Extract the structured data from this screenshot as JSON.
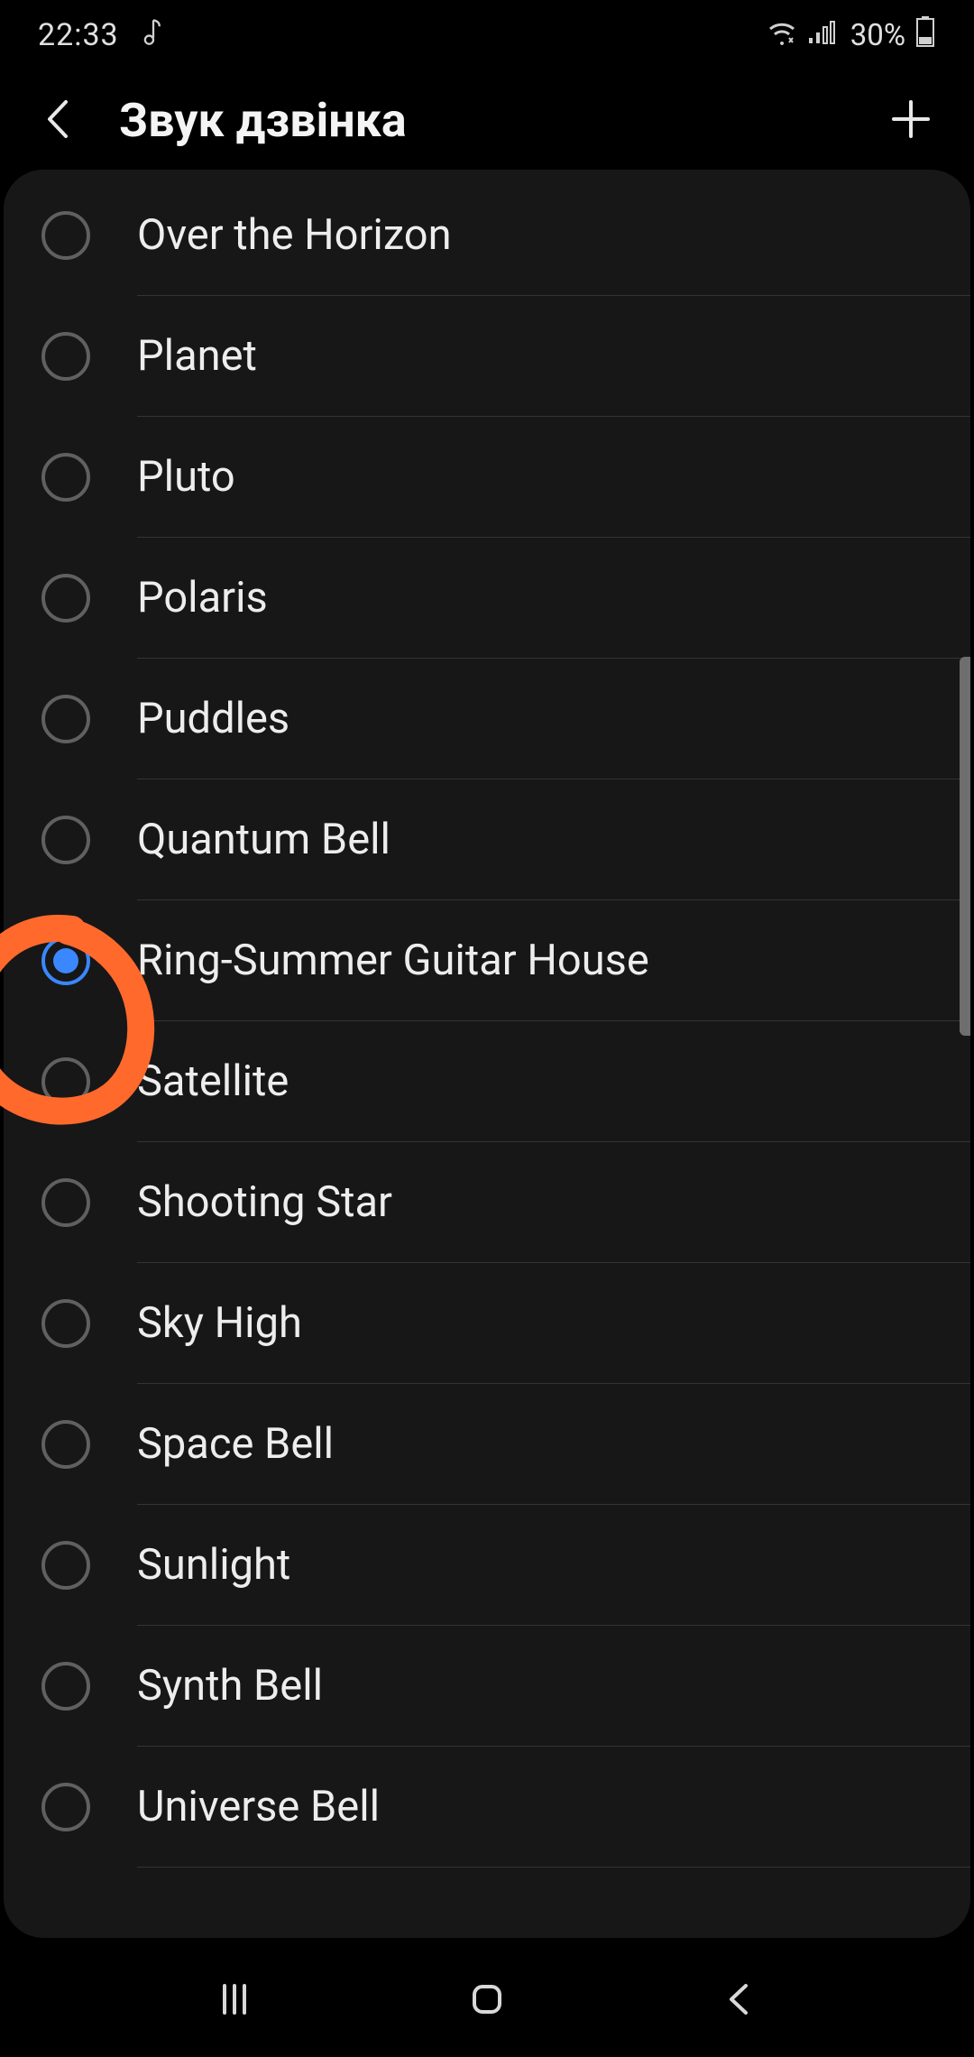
{
  "status_bar": {
    "time": "22:33",
    "music_icon": "music-note-icon",
    "wifi_icon": "wifi-icon",
    "signal_icon": "cell-signal-icon",
    "battery_percent": "30%",
    "battery_icon": "battery-icon"
  },
  "header": {
    "back_icon": "chevron-left-icon",
    "title": "Звук дзвінка",
    "add_icon": "plus-icon"
  },
  "ringtones": [
    {
      "label": "Over the Horizon",
      "selected": false
    },
    {
      "label": "Planet",
      "selected": false
    },
    {
      "label": "Pluto",
      "selected": false
    },
    {
      "label": "Polaris",
      "selected": false
    },
    {
      "label": "Puddles",
      "selected": false
    },
    {
      "label": "Quantum Bell",
      "selected": false
    },
    {
      "label": "Ring-Summer Guitar House",
      "selected": true
    },
    {
      "label": "Satellite",
      "selected": false
    },
    {
      "label": "Shooting Star",
      "selected": false
    },
    {
      "label": "Sky High",
      "selected": false
    },
    {
      "label": "Space Bell",
      "selected": false
    },
    {
      "label": "Sunlight",
      "selected": false
    },
    {
      "label": "Synth Bell",
      "selected": false
    },
    {
      "label": "Universe Bell",
      "selected": false
    }
  ],
  "nav_bar": {
    "recents_icon": "recents-icon",
    "home_icon": "home-icon",
    "back_icon": "back-icon"
  },
  "annotation": {
    "color": "#ff6a2c"
  }
}
